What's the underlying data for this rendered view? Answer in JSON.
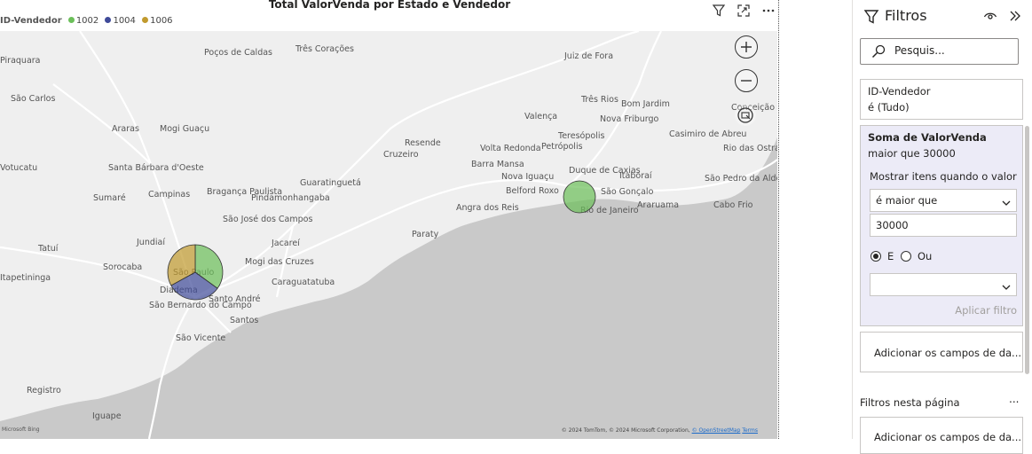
{
  "visual": {
    "title": "Total ValorVenda por Estado e Vendedor",
    "legend": {
      "title": "ID-Vendedor",
      "items": [
        {
          "label": "1002",
          "color": "#6bbf59"
        },
        {
          "label": "1004",
          "color": "#3f4a99"
        },
        {
          "label": "1006",
          "color": "#c19a2e"
        }
      ]
    },
    "header_icons": [
      "filter-icon",
      "focus-mode-icon",
      "more-options-icon"
    ]
  },
  "map": {
    "zoom_in": "+",
    "zoom_out": "−",
    "copyright": "© 2024 TomTom, © 2024 Microsoft Corporation,",
    "copyright_link": "© OpenStreetMap",
    "terms": "Terms",
    "logo": "Microsoft Bing",
    "places": [
      "Poços de Caldas",
      "Três Corações",
      "Juiz de Fora",
      "Três Rios",
      "Bom Jardim",
      "Nova Friburgo",
      "Teresópolis",
      "Volta Redonda",
      "Petrópolis",
      "Barra Mansa",
      "Resende",
      "Nova Iguaçu",
      "Duque de Caxias",
      "Itaboraí",
      "São Gonçalo",
      "Rio de Janeiro",
      "Belford Roxo",
      "Araruama",
      "Cabo Frio",
      "São Pedro da Aldeia",
      "Rio das Ostras",
      "Casimiro de Abreu",
      "Angra dos Reis",
      "Paraty",
      "Guaratinguetá",
      "Cruzeiro",
      "Valença",
      "Campinas",
      "Sumaré",
      "Santa Bárbara d'Oeste",
      "Jundiaí",
      "Bragança Paulista",
      "Pindamonhangaba",
      "São José dos Campos",
      "Jacareí",
      "Mogi das Cruzes",
      "Caraguatatuba",
      "São Paulo",
      "Diadema",
      "Santo André",
      "São Bernardo do Campo",
      "Santos",
      "São Vicente",
      "Sorocaba",
      "Tatuí",
      "Itapetininga",
      "Registro",
      "Iguape",
      "São Carlos",
      "Araras",
      "Mogi Guaçu",
      "Votucatu",
      "Piraquara",
      "Conceição de Macabu"
    ],
    "bubbles": [
      {
        "state": "São Paulo",
        "slices": [
          {
            "seller": "1002",
            "value": 35
          },
          {
            "seller": "1004",
            "value": 32
          },
          {
            "seller": "1006",
            "value": 33
          }
        ]
      },
      {
        "state": "Rio de Janeiro",
        "slices": [
          {
            "seller": "1002",
            "value": 100
          }
        ]
      }
    ]
  },
  "filters_pane": {
    "title": "Filtros",
    "search_placeholder": "Pesquis...",
    "filter_seller": {
      "name": "ID-Vendedor",
      "state": "é (Tudo)"
    },
    "filter_sum": {
      "name": "Soma de ValorVenda",
      "state": "maior que 30000",
      "show_items_label": "Mostrar itens quando o valor",
      "condition": "é maior que",
      "value": "30000",
      "logic_and": "E",
      "logic_or": "Ou",
      "second_condition": "",
      "apply": "Aplicar filtro"
    },
    "add_fields_visual": "Adicionar os campos de da...",
    "page_filters_label": "Filtros nesta página",
    "page_filters_more": "...",
    "add_fields_page": "Adicionar os campos de da..."
  }
}
